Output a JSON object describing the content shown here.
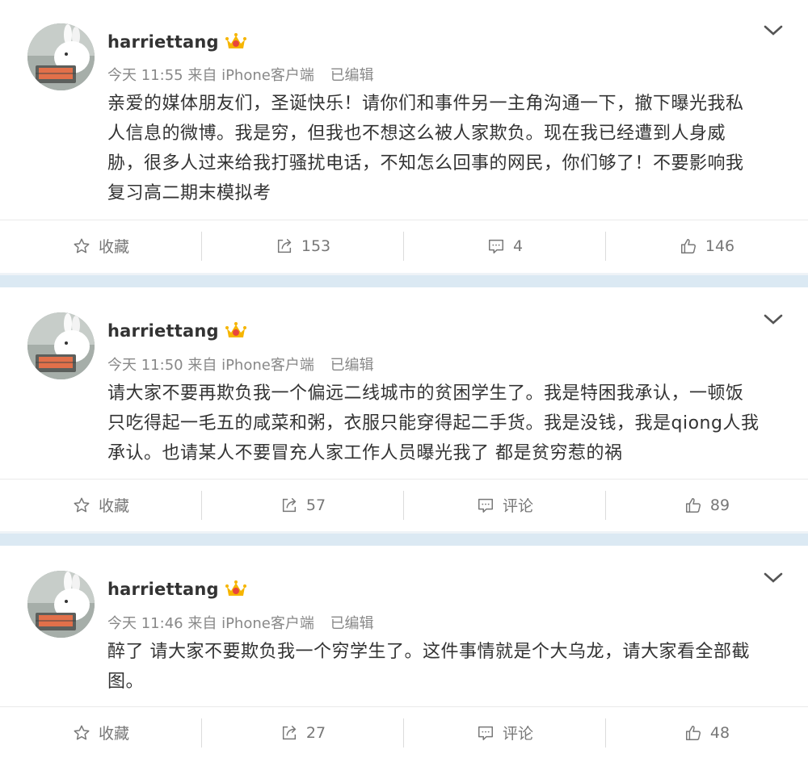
{
  "colors": {
    "accent": "#dbe9f3",
    "meta_text": "#888888",
    "body_text": "#333333",
    "icon": "#777777",
    "vip_badge": "#f6b500"
  },
  "posts": [
    {
      "username": "harriettang",
      "time": "今天 11:55",
      "source": "来自 iPhone客户端",
      "edited": "已编辑",
      "content_lines": [
        "亲爱的媒体朋友们，圣诞快乐！请你们和事件另一主角沟通一下，撤下曝光我私",
        "人信息的微博。我是穷，但我也不想这么被人家欺负。现在我已经遭到人身威",
        "胁，很多人过来给我打骚扰电话，不知怎么回事的网民，你们够了！不要影响我",
        "复习高二期末模拟考"
      ],
      "favorite_label": "收藏",
      "repost_count": "153",
      "comment_count": "4",
      "like_count": "146"
    },
    {
      "username": "harriettang",
      "time": "今天 11:50",
      "source": "来自 iPhone客户端",
      "edited": "已编辑",
      "content_lines": [
        "请大家不要再欺负我一个偏远二线城市的贫困学生了。我是特困我承认，一顿饭",
        "只吃得起一毛五的咸菜和粥，衣服只能穿得起二手货。我是没钱，我是qiong人我",
        "承认。也请某人不要冒充人家工作人员曝光我了 都是贫穷惹的祸"
      ],
      "favorite_label": "收藏",
      "repost_count": "57",
      "comment_count": "评论",
      "like_count": "89"
    },
    {
      "username": "harriettang",
      "time": "今天 11:46",
      "source": "来自 iPhone客户端",
      "edited": "已编辑",
      "content_lines": [
        "醉了 请大家不要欺负我一个穷学生了。这件事情就是个大乌龙，请大家看全部截",
        "图。"
      ],
      "favorite_label": "收藏",
      "repost_count": "27",
      "comment_count": "评论",
      "like_count": "48"
    }
  ]
}
